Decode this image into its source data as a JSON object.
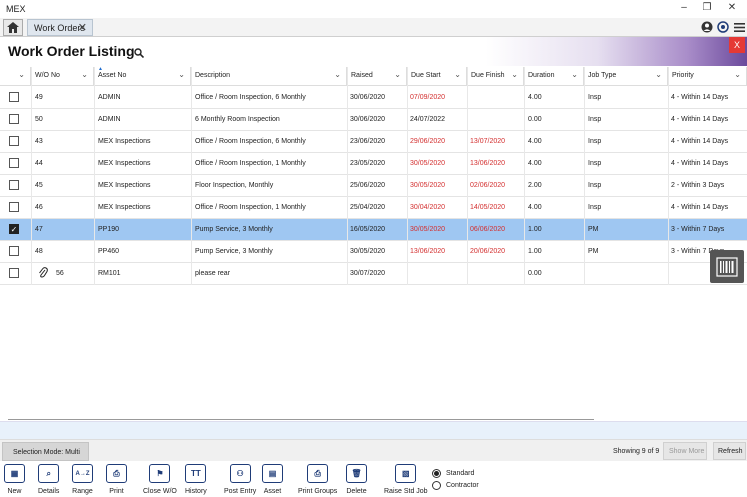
{
  "app": {
    "title": "MEX"
  },
  "tabs": [
    {
      "label": "Work Orders"
    }
  ],
  "page": {
    "title": "Work Order Listing",
    "close_label": "X"
  },
  "columns": [
    {
      "label": ""
    },
    {
      "label": "W/O No"
    },
    {
      "label": "Asset No"
    },
    {
      "label": "Description"
    },
    {
      "label": "Raised"
    },
    {
      "label": "Due Start"
    },
    {
      "label": "Due Finish"
    },
    {
      "label": "Duration"
    },
    {
      "label": "Job Type"
    },
    {
      "label": "Priority"
    }
  ],
  "rows": [
    {
      "checked": false,
      "wo": "49",
      "asset": "ADMIN",
      "desc": "Office / Room Inspection, 6 Monthly",
      "raised": "30/06/2020",
      "due_start": "07/09/2020",
      "due_start_red": true,
      "due_finish": "",
      "due_finish_red": false,
      "duration": "4.00",
      "job_type": "Insp",
      "priority": "4 - Within 14 Days",
      "attach": false
    },
    {
      "checked": false,
      "wo": "50",
      "asset": "ADMIN",
      "desc": "6 Monthly Room Inspection",
      "raised": "30/06/2020",
      "due_start": "24/07/2022",
      "due_start_red": false,
      "due_finish": "",
      "due_finish_red": false,
      "duration": "0.00",
      "job_type": "Insp",
      "priority": "4 - Within 14 Days",
      "attach": false
    },
    {
      "checked": false,
      "wo": "43",
      "asset": "MEX Inspections",
      "desc": "Office / Room Inspection, 6 Monthly",
      "raised": "23/06/2020",
      "due_start": "29/06/2020",
      "due_start_red": true,
      "due_finish": "13/07/2020",
      "due_finish_red": true,
      "duration": "4.00",
      "job_type": "Insp",
      "priority": "4 - Within 14 Days",
      "attach": false
    },
    {
      "checked": false,
      "wo": "44",
      "asset": "MEX Inspections",
      "desc": "Office / Room Inspection, 1 Monthly",
      "raised": "23/05/2020",
      "due_start": "30/05/2020",
      "due_start_red": true,
      "due_finish": "13/06/2020",
      "due_finish_red": true,
      "duration": "4.00",
      "job_type": "Insp",
      "priority": "4 - Within 14 Days",
      "attach": false
    },
    {
      "checked": false,
      "wo": "45",
      "asset": "MEX Inspections",
      "desc": "Floor Inspection, Monthly",
      "raised": "25/06/2020",
      "due_start": "30/05/2020",
      "due_start_red": true,
      "due_finish": "02/06/2020",
      "due_finish_red": true,
      "duration": "2.00",
      "job_type": "Insp",
      "priority": "2 - Within 3 Days",
      "attach": false
    },
    {
      "checked": false,
      "wo": "46",
      "asset": "MEX Inspections",
      "desc": "Office / Room Inspection, 1 Monthly",
      "raised": "25/04/2020",
      "due_start": "30/04/2020",
      "due_start_red": true,
      "due_finish": "14/05/2020",
      "due_finish_red": true,
      "duration": "4.00",
      "job_type": "Insp",
      "priority": "4 - Within 14 Days",
      "attach": false
    },
    {
      "checked": true,
      "wo": "47",
      "asset": "PP190",
      "desc": "Pump Service, 3 Monthly",
      "raised": "16/05/2020",
      "due_start": "30/05/2020",
      "due_start_red": true,
      "due_finish": "06/06/2020",
      "due_finish_red": true,
      "duration": "1.00",
      "job_type": "PM",
      "priority": "3 - Within 7 Days",
      "attach": false
    },
    {
      "checked": false,
      "wo": "48",
      "asset": "PP460",
      "desc": "Pump Service, 3 Monthly",
      "raised": "30/05/2020",
      "due_start": "13/06/2020",
      "due_start_red": true,
      "due_finish": "20/06/2020",
      "due_finish_red": true,
      "duration": "1.00",
      "job_type": "PM",
      "priority": "3 - Within 7 Days",
      "attach": false
    },
    {
      "checked": false,
      "wo": "56",
      "asset": "RM101",
      "desc": "please rear",
      "raised": "30/07/2020",
      "due_start": "",
      "due_start_red": false,
      "due_finish": "",
      "due_finish_red": false,
      "duration": "0.00",
      "job_type": "",
      "priority": "",
      "attach": true
    }
  ],
  "status": {
    "selection_mode": "Selection Mode: Multi",
    "showing": "Showing 9 of 9",
    "show_more": "Show More",
    "refresh": "Refresh"
  },
  "toolbar": [
    {
      "label": "New",
      "icon": "new-icon"
    },
    {
      "label": "Details",
      "icon": "details-icon"
    },
    {
      "label": "Range",
      "icon": "range-icon"
    },
    {
      "label": "Print",
      "icon": "print-icon"
    },
    {
      "label": "Close W/O",
      "icon": "close-wo-icon"
    },
    {
      "label": "History",
      "icon": "history-icon"
    },
    {
      "label": "Post Entry",
      "icon": "post-entry-icon"
    },
    {
      "label": "Asset",
      "icon": "asset-icon"
    },
    {
      "label": "Print Groups",
      "icon": "print-groups-icon"
    },
    {
      "label": "Delete",
      "icon": "delete-icon"
    },
    {
      "label": "Raise Std Job",
      "icon": "raise-std-job-icon"
    }
  ],
  "radios": [
    {
      "label": "Standard",
      "checked": true
    },
    {
      "label": "Contractor",
      "checked": false
    }
  ],
  "colors": {
    "selected_row": "#9fc7f2",
    "overdue": "#d32f2f",
    "icon_blue": "#1f3c78",
    "close_red": "#e53935"
  }
}
